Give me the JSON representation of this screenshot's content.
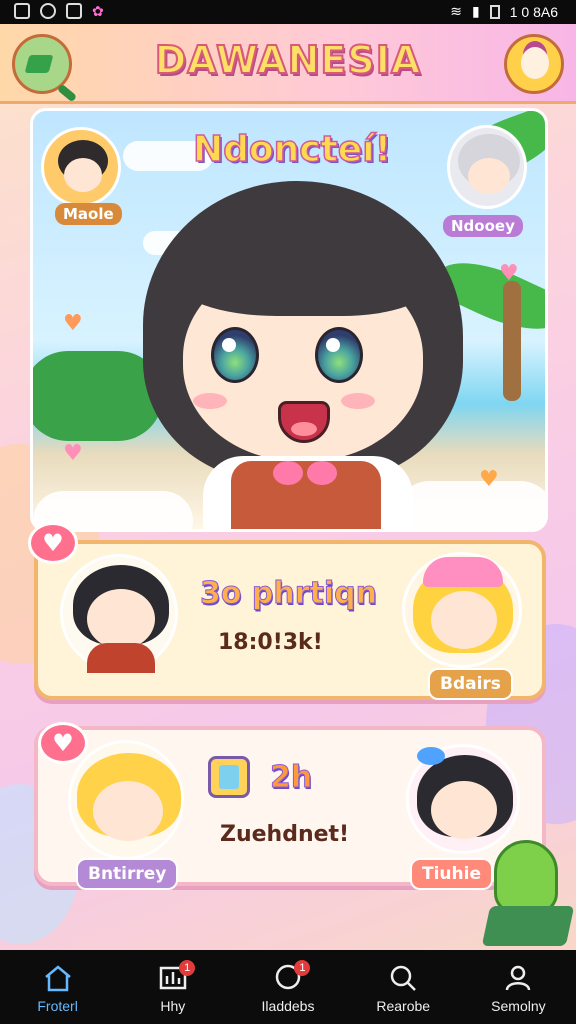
{
  "status_bar": {
    "time": "1 0 8A6"
  },
  "header": {
    "title": "DAWANESIA"
  },
  "hero": {
    "heading": "Ndoncteí!",
    "avatar_left_label": "Maole",
    "avatar_right_label": "Ndooey"
  },
  "cards": [
    {
      "title": "3o phrtiqn",
      "text": "18:0!3k!",
      "right_chip": "Bdairs",
      "left_chip": ""
    },
    {
      "title": "2h",
      "text": "Zuehdnet!",
      "left_chip": "Bntirrey",
      "right_chip": "Tiuhie"
    }
  ],
  "bottom_nav": [
    {
      "label": "Froterl",
      "icon": "home-icon",
      "badge": "",
      "active": true
    },
    {
      "label": "Hhy",
      "icon": "chart-icon",
      "badge": "1",
      "active": false
    },
    {
      "label": "Iladdebs",
      "icon": "chat-bubble-icon",
      "badge": "1",
      "active": false
    },
    {
      "label": "Rearobe",
      "icon": "search-icon",
      "badge": "",
      "active": false
    },
    {
      "label": "Semolny",
      "icon": "profile-icon",
      "badge": "",
      "active": false
    }
  ],
  "colors": {
    "accent": "#f2b56d",
    "active_nav": "#64b9ff",
    "badge": "#e23b3b"
  }
}
